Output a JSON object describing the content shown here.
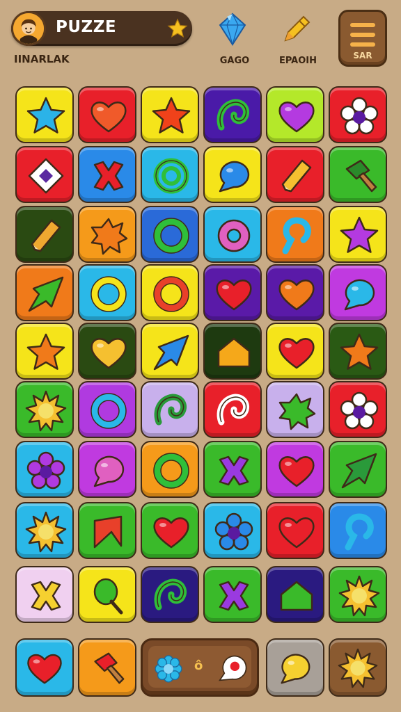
{
  "header": {
    "title": "PUZZE",
    "subtitle": "IINARLAK",
    "avatar_icon": "player-avatar",
    "title_icon": "star-icon",
    "items": [
      {
        "label": "GAGO",
        "icon": "blue-gem-icon"
      },
      {
        "label": "EPAOIH",
        "icon": "gold-pencil-icon"
      }
    ],
    "menu": {
      "label": "SAR",
      "icon": "menu-icon"
    }
  },
  "board": {
    "rows": 9,
    "cols": 6,
    "tiles": [
      [
        {
          "bg": "#f5e41a",
          "icon": "star",
          "color": "#2bb3e8"
        },
        {
          "bg": "#e8202a",
          "icon": "heart",
          "color": "#f05a2a"
        },
        {
          "bg": "#f5e41a",
          "icon": "star",
          "color": "#f0421a"
        },
        {
          "bg": "#4a1aa8",
          "icon": "swirl",
          "color": "#2fbf3a"
        },
        {
          "bg": "#b4e82a",
          "icon": "heart",
          "color": "#b43ae0"
        },
        {
          "bg": "#e8202a",
          "icon": "flower",
          "color": "#ffffff"
        }
      ],
      [
        {
          "bg": "#e8202a",
          "icon": "diamond",
          "color": "#ffffff"
        },
        {
          "bg": "#2a8ae8",
          "icon": "cross",
          "color": "#e8202a"
        },
        {
          "bg": "#2ab8e8",
          "icon": "spiral",
          "color": "#2fbf3a"
        },
        {
          "bg": "#f5e41a",
          "icon": "bubble",
          "color": "#2a8ae8"
        },
        {
          "bg": "#e8202a",
          "icon": "pencil",
          "color": "#f5c030"
        },
        {
          "bg": "#3aba2a",
          "icon": "hammer",
          "color": "#2a8a2a"
        }
      ],
      [
        {
          "bg": "#2a4a12",
          "icon": "pencil",
          "color": "#f0a830"
        },
        {
          "bg": "#f59a1a",
          "icon": "splat",
          "color": "#f07a1a"
        },
        {
          "bg": "#2a6ad8",
          "icon": "ring",
          "color": "#2fbf3a"
        },
        {
          "bg": "#2ab8e8",
          "icon": "donut",
          "color": "#e060c0"
        },
        {
          "bg": "#f07a1a",
          "icon": "hook",
          "color": "#2ab8e8"
        },
        {
          "bg": "#f5e41a",
          "icon": "star",
          "color": "#b43ae0"
        }
      ],
      [
        {
          "bg": "#f07a1a",
          "icon": "arrow",
          "color": "#3aba2a"
        },
        {
          "bg": "#2ab8e8",
          "icon": "ring",
          "color": "#f5e41a"
        },
        {
          "bg": "#f5e41a",
          "icon": "ring",
          "color": "#e8402a"
        },
        {
          "bg": "#5a1aa8",
          "icon": "heart",
          "color": "#e8202a"
        },
        {
          "bg": "#5a1aa8",
          "icon": "heart",
          "color": "#f07a1a"
        },
        {
          "bg": "#c03ae0",
          "icon": "bubble",
          "color": "#2ab8e8"
        }
      ],
      [
        {
          "bg": "#f5e41a",
          "icon": "star",
          "color": "#f07a1a"
        },
        {
          "bg": "#2a4a12",
          "icon": "heart",
          "color": "#f5c030"
        },
        {
          "bg": "#f5e41a",
          "icon": "arrow",
          "color": "#2a8ae8"
        },
        {
          "bg": "#1e3a10",
          "icon": "house",
          "color": "#f5a81a"
        },
        {
          "bg": "#f5e41a",
          "icon": "heart",
          "color": "#e8202a"
        },
        {
          "bg": "#2a5a14",
          "icon": "star",
          "color": "#f07a1a"
        }
      ],
      [
        {
          "bg": "#3aba2a",
          "icon": "sun",
          "color": "#f5c030"
        },
        {
          "bg": "#b03ae0",
          "icon": "ring",
          "color": "#2ab8e8"
        },
        {
          "bg": "#c8b0ec",
          "icon": "swirl",
          "color": "#2a9a3a"
        },
        {
          "bg": "#e8202a",
          "icon": "swirl",
          "color": "#ffffff"
        },
        {
          "bg": "#c8b0ec",
          "icon": "splat",
          "color": "#3aba2a"
        },
        {
          "bg": "#e8202a",
          "icon": "flower",
          "color": "#ffffff"
        }
      ],
      [
        {
          "bg": "#2ab8e8",
          "icon": "flower",
          "color": "#b03ae0"
        },
        {
          "bg": "#c03ae0",
          "icon": "bubble",
          "color": "#e060c0"
        },
        {
          "bg": "#f59a1a",
          "icon": "ring",
          "color": "#2fbf3a"
        },
        {
          "bg": "#3aba2a",
          "icon": "cross",
          "color": "#9a3ae0"
        },
        {
          "bg": "#c03ae0",
          "icon": "heart",
          "color": "#e8202a"
        },
        {
          "bg": "#3aba2a",
          "icon": "arrow",
          "color": "#2a9a3a"
        }
      ],
      [
        {
          "bg": "#2ab8e8",
          "icon": "sun",
          "color": "#f5c030"
        },
        {
          "bg": "#3aba2a",
          "icon": "flag",
          "color": "#e8402a"
        },
        {
          "bg": "#3aba2a",
          "icon": "heart",
          "color": "#e8202a"
        },
        {
          "bg": "#2ab8e8",
          "icon": "flower",
          "color": "#2a8ae8"
        },
        {
          "bg": "#e8202a",
          "icon": "heart",
          "color": "#e8202a"
        },
        {
          "bg": "#2a8ae8",
          "icon": "hook",
          "color": "#2ab8e8"
        }
      ],
      [
        {
          "bg": "#f0d0f0",
          "icon": "cross",
          "color": "#f5d030"
        },
        {
          "bg": "#f5e41a",
          "icon": "lollipop",
          "color": "#3aba2a"
        },
        {
          "bg": "#2a1a80",
          "icon": "swirl",
          "color": "#2fbf3a"
        },
        {
          "bg": "#3aba2a",
          "icon": "cross",
          "color": "#9a3ae0"
        },
        {
          "bg": "#2a1a80",
          "icon": "house",
          "color": "#3aba2a"
        },
        {
          "bg": "#3aba2a",
          "icon": "sun",
          "color": "#f5c030"
        }
      ]
    ]
  },
  "bottom_bar": {
    "left_tiles": [
      {
        "bg": "#2ab8e8",
        "icon": "heart",
        "color": "#e8202a"
      },
      {
        "bg": "#f59a1a",
        "icon": "hammer",
        "color": "#e8202a"
      }
    ],
    "tray": {
      "label": "ô",
      "icons": [
        "flower-icon",
        "speech-flower-icon"
      ]
    },
    "right_tiles": [
      {
        "bg": "#a8a098",
        "icon": "bubble",
        "color": "#f5d030"
      },
      {
        "bg": "#8a5a30",
        "icon": "sun",
        "color": "#f5c030"
      }
    ]
  }
}
